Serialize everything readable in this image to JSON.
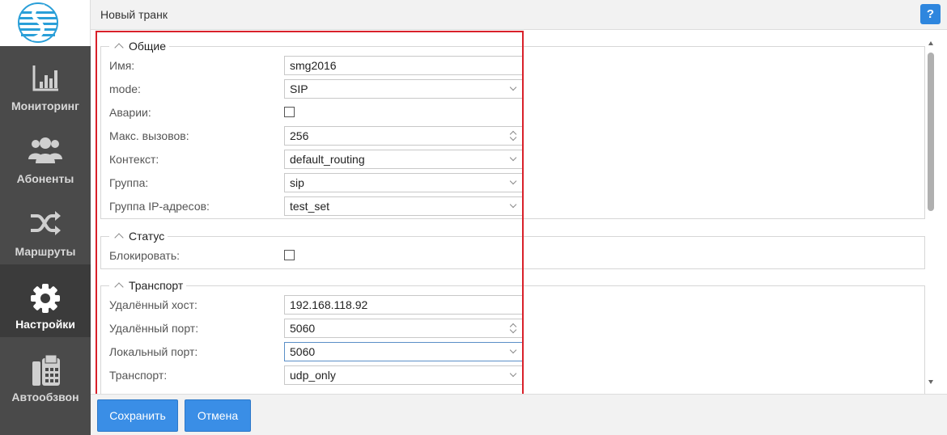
{
  "sidebar": {
    "items": [
      {
        "label": "Мониторинг",
        "icon": "bar-chart-icon"
      },
      {
        "label": "Абоненты",
        "icon": "users-icon"
      },
      {
        "label": "Маршруты",
        "icon": "shuffle-icon"
      },
      {
        "label": "Настройки",
        "icon": "gear-icon",
        "active": true
      },
      {
        "label": "Автообзвон",
        "icon": "fax-icon"
      }
    ]
  },
  "header": {
    "title": "Новый транк",
    "help": "?"
  },
  "sections": {
    "general": {
      "legend": "Общие",
      "name_label": "Имя:",
      "name_value": "smg2016",
      "mode_label": "mode:",
      "mode_value": "SIP",
      "alarms_label": "Аварии:",
      "max_calls_label": "Макс. вызовов:",
      "max_calls_value": "256",
      "context_label": "Контекст:",
      "context_value": "default_routing",
      "group_label": "Группа:",
      "group_value": "sip",
      "ip_group_label": "Группа IP-адресов:",
      "ip_group_value": "test_set"
    },
    "status": {
      "legend": "Статус",
      "block_label": "Блокировать:"
    },
    "transport": {
      "legend": "Транспорт",
      "remote_host_label": "Удалённый хост:",
      "remote_host_value": "192.168.118.92",
      "remote_port_label": "Удалённый порт:",
      "remote_port_value": "5060",
      "local_port_label": "Локальный порт:",
      "local_port_value": "5060",
      "transport_label": "Транспорт:",
      "transport_value": "udp_only"
    }
  },
  "footer": {
    "save_label": "Сохранить",
    "cancel_label": "Отмена"
  },
  "colors": {
    "accent": "#3a8ee6",
    "sidebar": "#4a4a4a",
    "highlight": "#d9212a"
  }
}
